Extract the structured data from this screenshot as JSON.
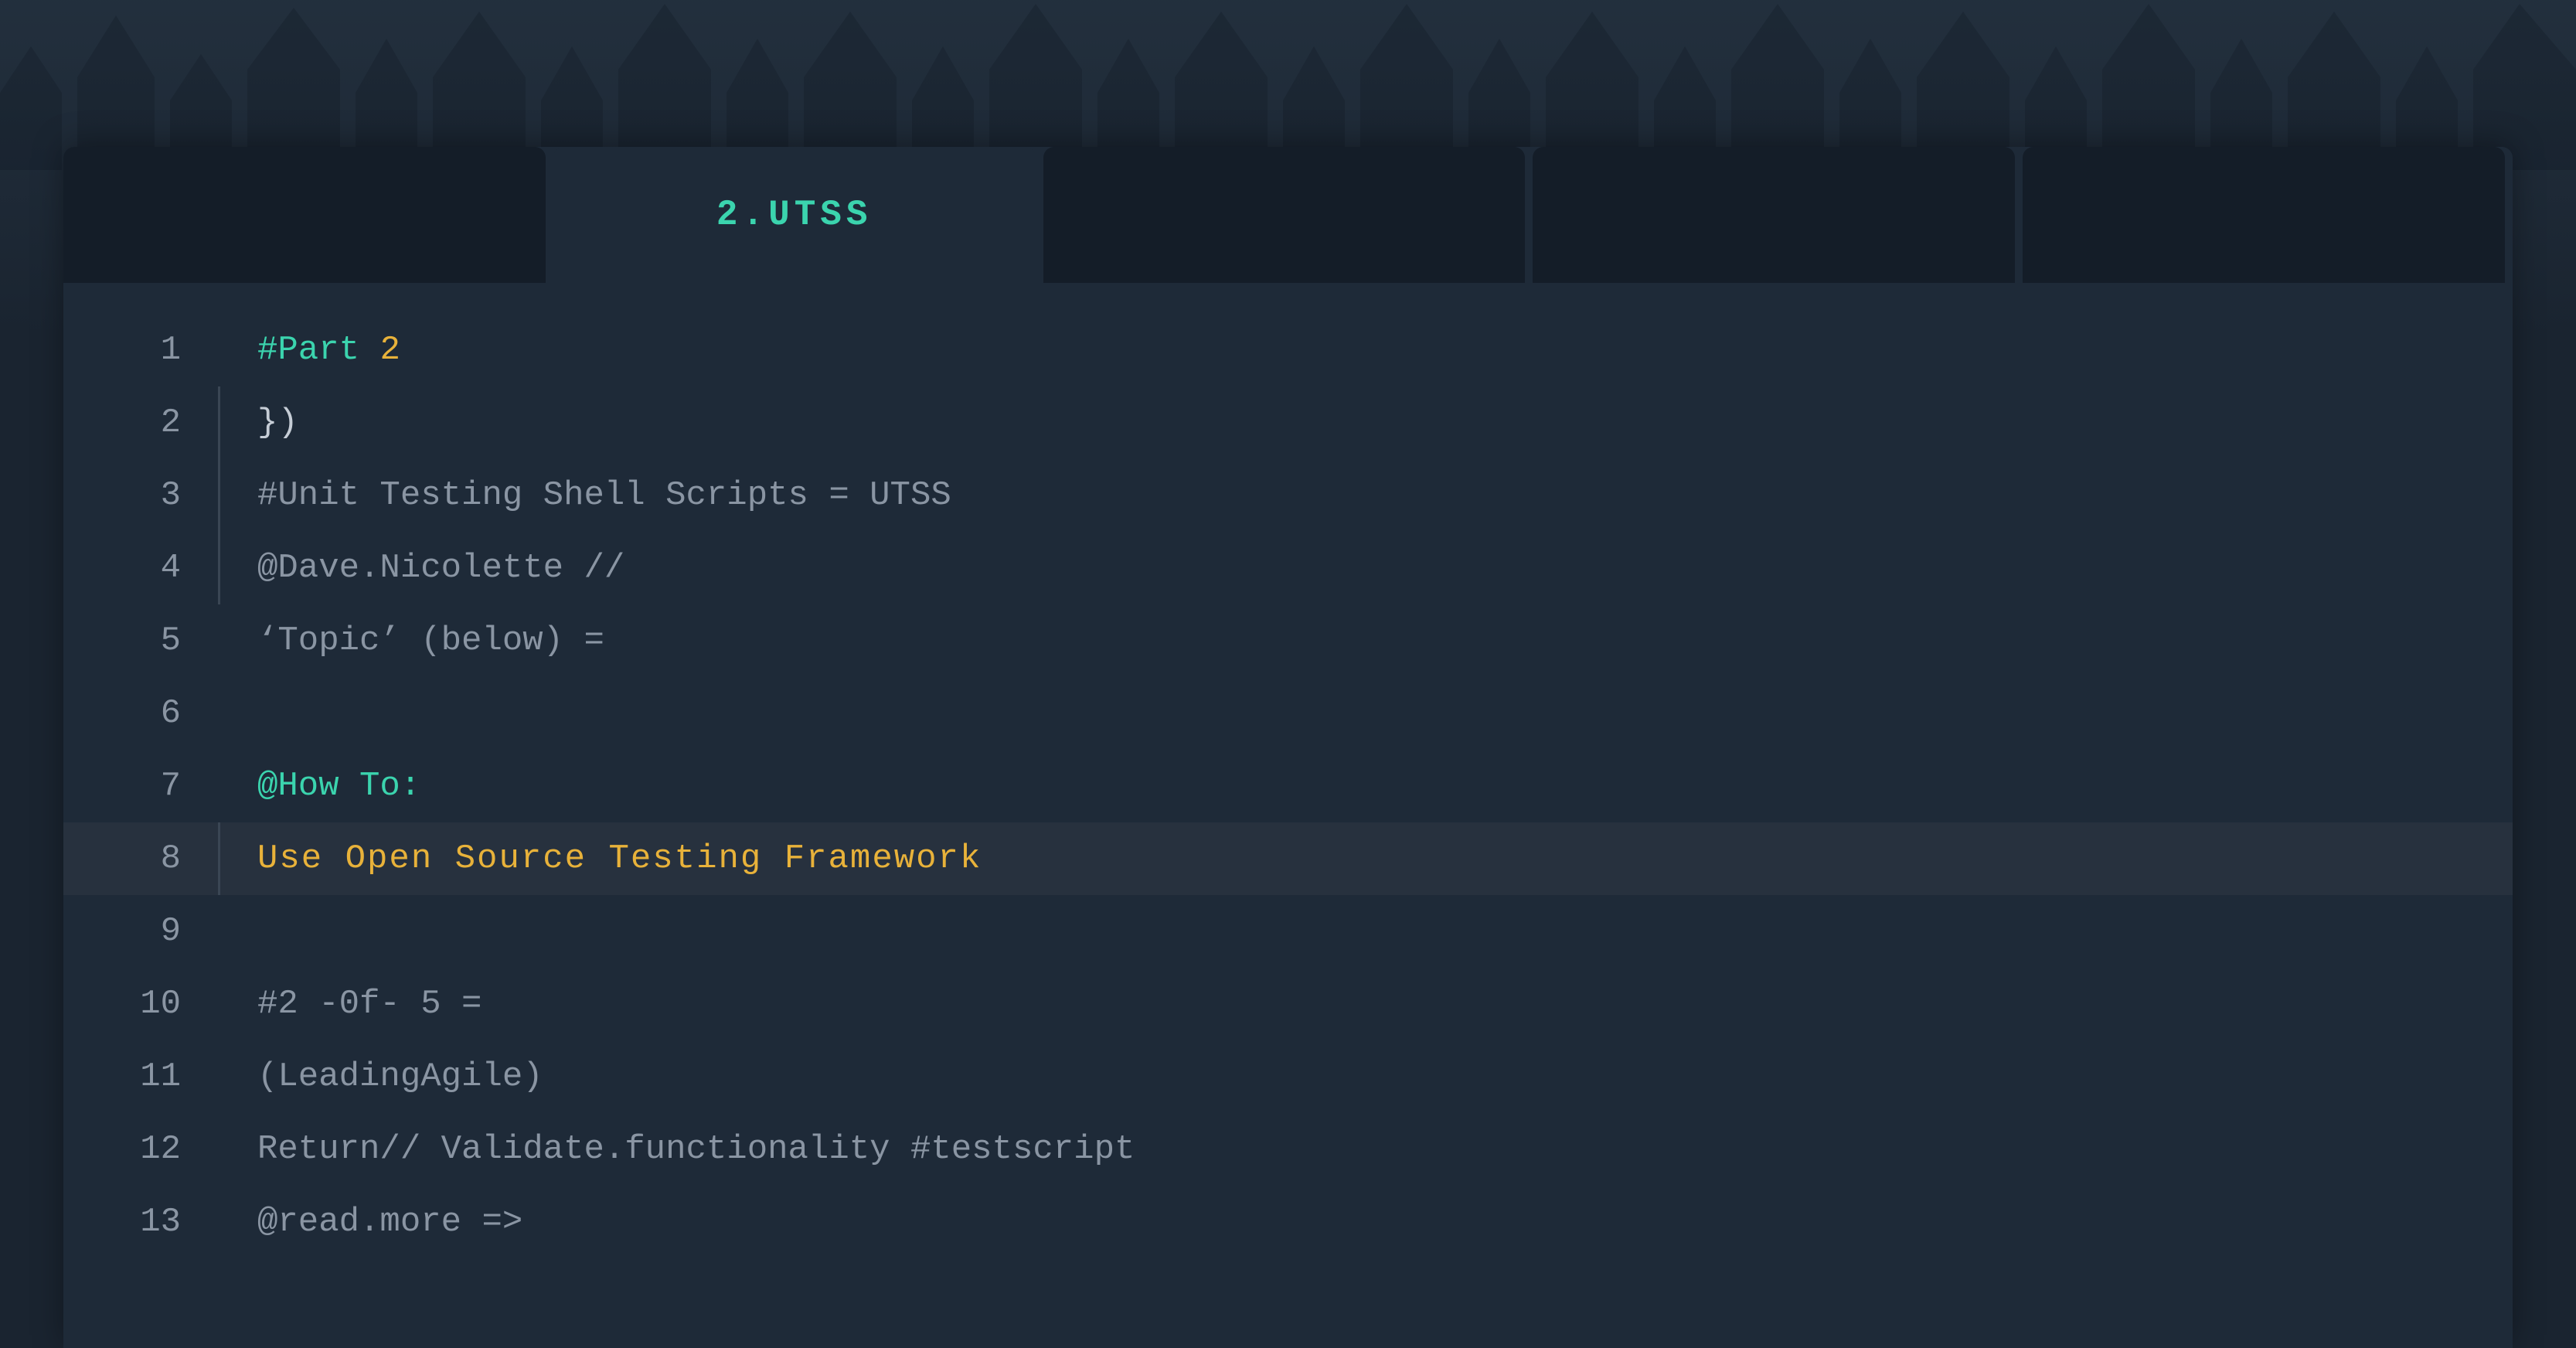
{
  "colors": {
    "bg": "#1a2430",
    "panel": "#1e2a38",
    "tab_inactive": "#141d28",
    "accent": "#3bd4ae",
    "gold": "#e8b23a",
    "muted": "#8a95a3",
    "highlight_row": "#27313e"
  },
  "tabs": [
    {
      "label": "",
      "active": false
    },
    {
      "label": "2.UTSS",
      "active": true
    },
    {
      "label": "",
      "active": false
    },
    {
      "label": "",
      "active": false
    },
    {
      "label": "",
      "active": false
    }
  ],
  "highlighted_line": 8,
  "lines": [
    {
      "n": 1,
      "guide": false,
      "tokens": [
        {
          "t": "#Part ",
          "c": "tok-hash"
        },
        {
          "t": "2",
          "c": "tok-num"
        }
      ]
    },
    {
      "n": 2,
      "guide": true,
      "tokens": [
        {
          "t": "})",
          "c": "tok-punc"
        }
      ]
    },
    {
      "n": 3,
      "guide": true,
      "tokens": [
        {
          "t": "#Unit Testing Shell Scripts = UTSS",
          "c": "tok-plain"
        }
      ]
    },
    {
      "n": 4,
      "guide": true,
      "tokens": [
        {
          "t": "@Dave.Nicolette //",
          "c": "tok-plain"
        }
      ]
    },
    {
      "n": 5,
      "guide": false,
      "tokens": [
        {
          "t": "‘Topic’ (below) =",
          "c": "tok-plain"
        }
      ]
    },
    {
      "n": 6,
      "guide": false,
      "tokens": []
    },
    {
      "n": 7,
      "guide": false,
      "tokens": [
        {
          "t": "@How To:",
          "c": "tok-at"
        }
      ]
    },
    {
      "n": 8,
      "guide": true,
      "tokens": [
        {
          "t": "Use Open Source Testing Framework",
          "c": "tok-gold"
        }
      ]
    },
    {
      "n": 9,
      "guide": false,
      "tokens": []
    },
    {
      "n": 10,
      "guide": false,
      "tokens": [
        {
          "t": "#2 -0f- 5 =",
          "c": "tok-plain"
        }
      ]
    },
    {
      "n": 11,
      "guide": false,
      "tokens": [
        {
          "t": "(LeadingAgile)",
          "c": "tok-plain"
        }
      ]
    },
    {
      "n": 12,
      "guide": false,
      "tokens": [
        {
          "t": "Return// Validate.functionality #testscript",
          "c": "tok-plain"
        }
      ]
    },
    {
      "n": 13,
      "guide": false,
      "tokens": [
        {
          "t": "@read.more =>",
          "c": "tok-plain"
        }
      ]
    }
  ]
}
